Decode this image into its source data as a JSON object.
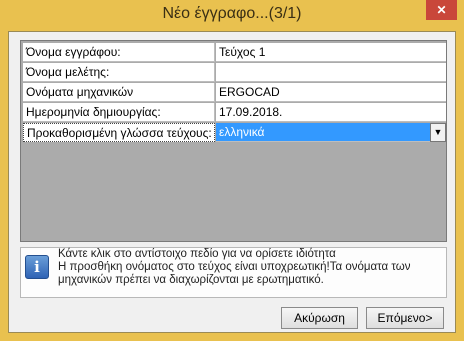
{
  "window": {
    "title": "Νέο έγγραφο...(3/1)",
    "close_glyph": "✕"
  },
  "properties": {
    "rows": [
      {
        "label": "Όνομα εγγράφου:",
        "value": "Τεύχος 1"
      },
      {
        "label": "Όνομα μελέτης:",
        "value": ""
      },
      {
        "label": "Ονόματα μηχανικών",
        "value": "ERGOCAD"
      },
      {
        "label": "Ημερομηνία δημιουργίας:",
        "value": "17.09.2018."
      },
      {
        "label": "Προκαθορισμένη γλώσσα τεύχους:",
        "value": "ελληνικά"
      }
    ],
    "dropdown_glyph": "▼",
    "selected_color": "#3399ff"
  },
  "info": {
    "icon": "info-icon",
    "lines": [
      "Κάντε κλικ στο αντίστοιχο πεδίο για να ορίσετε ιδιότητα",
      "Η προσθήκη ονόματος στο τεύχος είναι υποχρεωτική!Τα ονόματα των",
      "μηχανικών πρέπει να διαχωρίζονται με ερωτηματικό."
    ]
  },
  "buttons": {
    "cancel": "Ακύρωση",
    "next": "Επόμενο>"
  }
}
